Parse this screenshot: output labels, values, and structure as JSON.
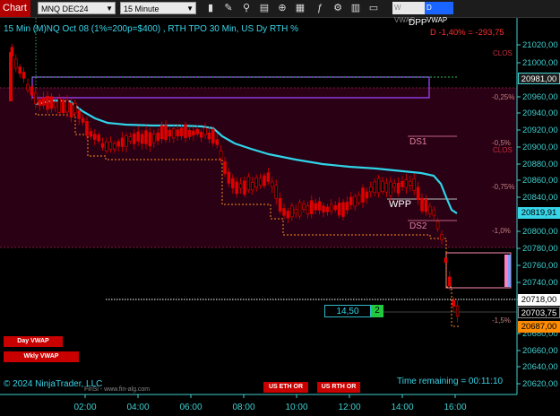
{
  "toolbar": {
    "chart_tab": "Chart",
    "instrument": "MNQ DEC24",
    "interval": "15 Minute",
    "icons": [
      "bar-chart-icon",
      "pencil-icon",
      "magnifier-icon",
      "properties-icon",
      "crosshair-icon",
      "templates-icon",
      "strategies-icon",
      "indicators-icon",
      "tile-icon"
    ],
    "tags": [
      {
        "label": "W VWAP",
        "bg": "#e8e8e8",
        "color": "#888888"
      },
      {
        "label": "D VWAP",
        "bg": "#1a64ff",
        "color": "#ffffff"
      }
    ]
  },
  "header": {
    "title": "15 Min (M)NQ Oct 08 (1%=200p=$400) , RTH TPO 30 Min, US Dy RTH %",
    "dpp": "DPP",
    "change": "D -1,40% = -293,75"
  },
  "levels": {
    "clos1": "CLOS",
    "clos2": "CLOS",
    "pct_025": "-0,25%",
    "pct_05": "-0,5%",
    "pct_075": "-0,75%",
    "pct_1": "-1,0%",
    "pct_15": "-1,5%",
    "ds1": "DS1",
    "ds2": "DS2",
    "wpp": "WPP"
  },
  "y_axis": {
    "ticks": [
      "21020,00",
      "21000,00",
      "20960,00",
      "20940,00",
      "20920,00",
      "20900,00",
      "20880,00",
      "20860,00",
      "20840,00",
      "20800,00",
      "20780,00",
      "20760,00",
      "20740,00",
      "20720,00",
      "20680,00",
      "20660,00",
      "20640,00",
      "20620,00"
    ],
    "labels": [
      {
        "value": "20981,00",
        "bg": "#1f1f1f",
        "color": "#ffffff",
        "border": "#3fd0d0"
      },
      {
        "value": "20819,91",
        "bg": "#38d4e8",
        "color": "#000000",
        "border": "#38d4e8"
      },
      {
        "value": "20718,00",
        "bg": "#ffffff",
        "color": "#000000",
        "border": "#ffffff"
      },
      {
        "value": "20703,75",
        "bg": "#000000",
        "color": "#ffffff",
        "border": "#888888"
      },
      {
        "value": "20687,00",
        "bg": "#ff8c00",
        "color": "#000000",
        "border": "#ff8c00"
      }
    ]
  },
  "x_axis": {
    "ticks": [
      "02:00",
      "04:00",
      "06:00",
      "08:00",
      "10:00",
      "12:00",
      "14:00",
      "16:00"
    ]
  },
  "order": {
    "price": "14,50",
    "qty": "2"
  },
  "buttons": {
    "day_vwap": "Day VWAP",
    "wkly_vwap": "Wkly VWAP",
    "us_eth_or": "US ETH OR",
    "us_rth_or": "US RTH OR"
  },
  "footer": {
    "copyright": "© 2024 NinjaTrader, LLC",
    "watermark": "FinSi - www.fin-alg.com",
    "time_remaining": "Time remaining = 00:11:10"
  },
  "colors": {
    "vwap": "#2fd4e8",
    "candle": "#e00000",
    "axis": "#3fd0d0",
    "zone": "#2a0014"
  }
}
